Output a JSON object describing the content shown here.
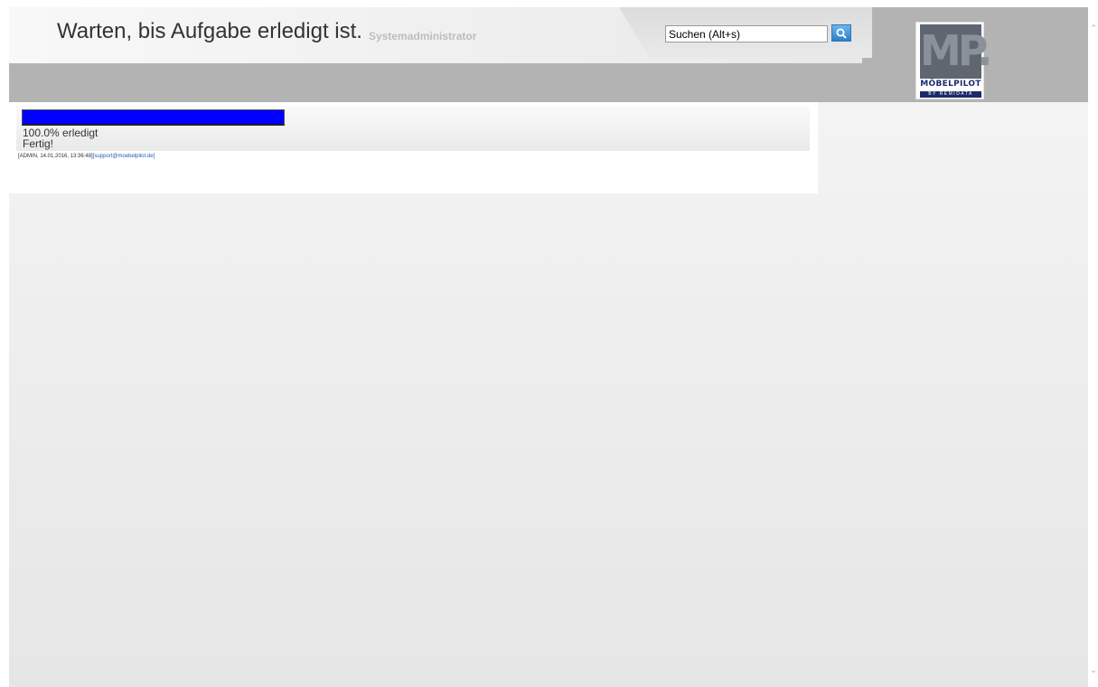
{
  "header": {
    "title": "Warten, bis Aufgabe erledigt ist.",
    "user_role": "Systemadministrator",
    "search_value": "Suchen (Alt+s)",
    "search_icon": "magnifier-icon",
    "logo_letters": "MP.",
    "logo_name": "MÖBELPILOT",
    "logo_sub": "BY REMIDATA"
  },
  "task": {
    "progress_fraction": 1.0,
    "progress_label": "100.0% erledigt",
    "status_label": "Fertig!",
    "progress_color": "#0000ff"
  },
  "footer": {
    "info": "[ADMIN, 14.01.2016, 13:36:48]",
    "support_link": "[support@moebelpilot.de]"
  },
  "scrollbar": {
    "up_icon": "chevron-up-icon",
    "down_icon": "chevron-down-icon"
  }
}
